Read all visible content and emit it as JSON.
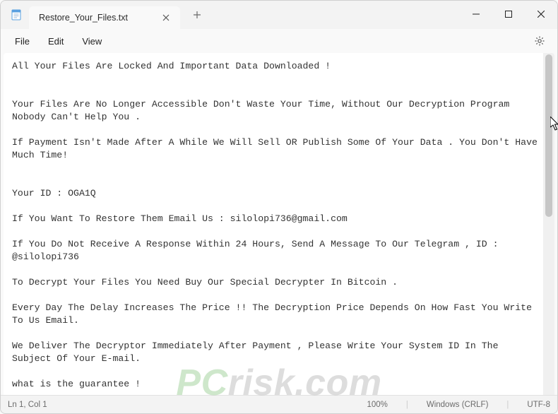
{
  "titlebar": {
    "tab_title": "Restore_Your_Files.txt"
  },
  "menubar": {
    "file": "File",
    "edit": "Edit",
    "view": "View"
  },
  "content": {
    "text": "All Your Files Are Locked And Important Data Downloaded !\n\n\nYour Files Are No Longer Accessible Don't Waste Your Time, Without Our Decryption Program Nobody Can't Help You .\n\nIf Payment Isn't Made After A While We Will Sell OR Publish Some Of Your Data . You Don't Have Much Time!\n\n\nYour ID : OGA1Q\n\nIf You Want To Restore Them Email Us : silolopi736@gmail.com\n\nIf You Do Not Receive A Response Within 24 Hours, Send A Message To Our Telegram , ID : @silolopi736\n\nTo Decrypt Your Files You Need Buy Our Special Decrypter In Bitcoin .\n\nEvery Day The Delay Increases The Price !! The Decryption Price Depends On How Fast You Write To Us Email.\n\nWe Deliver The Decryptor Immediately After Payment , Please Write Your System ID In The Subject Of Your E-mail.\n\nwhat is the guarantee !"
  },
  "statusbar": {
    "position": "Ln 1, Col 1",
    "zoom": "100%",
    "platform": "Windows (CRLF)",
    "encoding": "UTF-8"
  },
  "watermark": {
    "prefix": "PC",
    "suffix": "risk.com"
  }
}
